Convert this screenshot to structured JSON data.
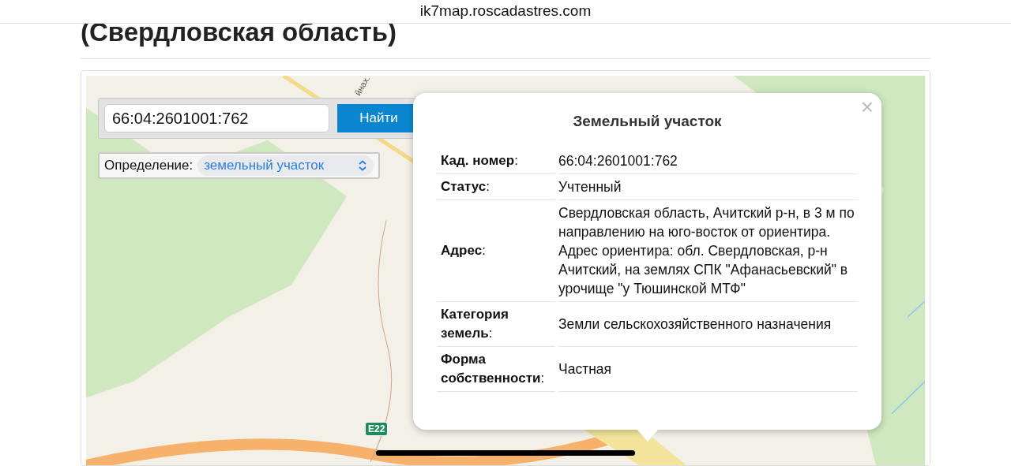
{
  "browser": {
    "url": "ik7map.roscadastres.com"
  },
  "page": {
    "heading": "(Свердловская область)"
  },
  "map": {
    "labels": [
      {
        "kind": "road-shield",
        "text": "E22"
      },
      {
        "kind": "street",
        "text": "йнах."
      }
    ]
  },
  "search": {
    "value": "66:04:2601001:762",
    "button": "Найти"
  },
  "definition": {
    "label": "Определение:",
    "value": "земельный участок"
  },
  "popup": {
    "close": "×",
    "title": "Земельный участок",
    "rows": [
      {
        "label": "**Кад. номер**:",
        "value": "66:04:2601001:762"
      },
      {
        "label": "**Статус**:",
        "value": "Учтенный"
      },
      {
        "label": "**Адрес**:",
        "value": "Свердловская область, Ачитский р-н, в 3 м по направлению на юго-восток от ориентира. Адрес ориентира: обл. Свердловская, р-н Ачитский, на землях СПК \"Афанасьевский\" в урочище \"у Тюшинской МТФ\""
      },
      {
        "label": "**Категория земель**:",
        "value": "Земли сельскохозяйственного назначения"
      },
      {
        "label": "**Форма собственности**:",
        "value": "Частная"
      }
    ]
  }
}
